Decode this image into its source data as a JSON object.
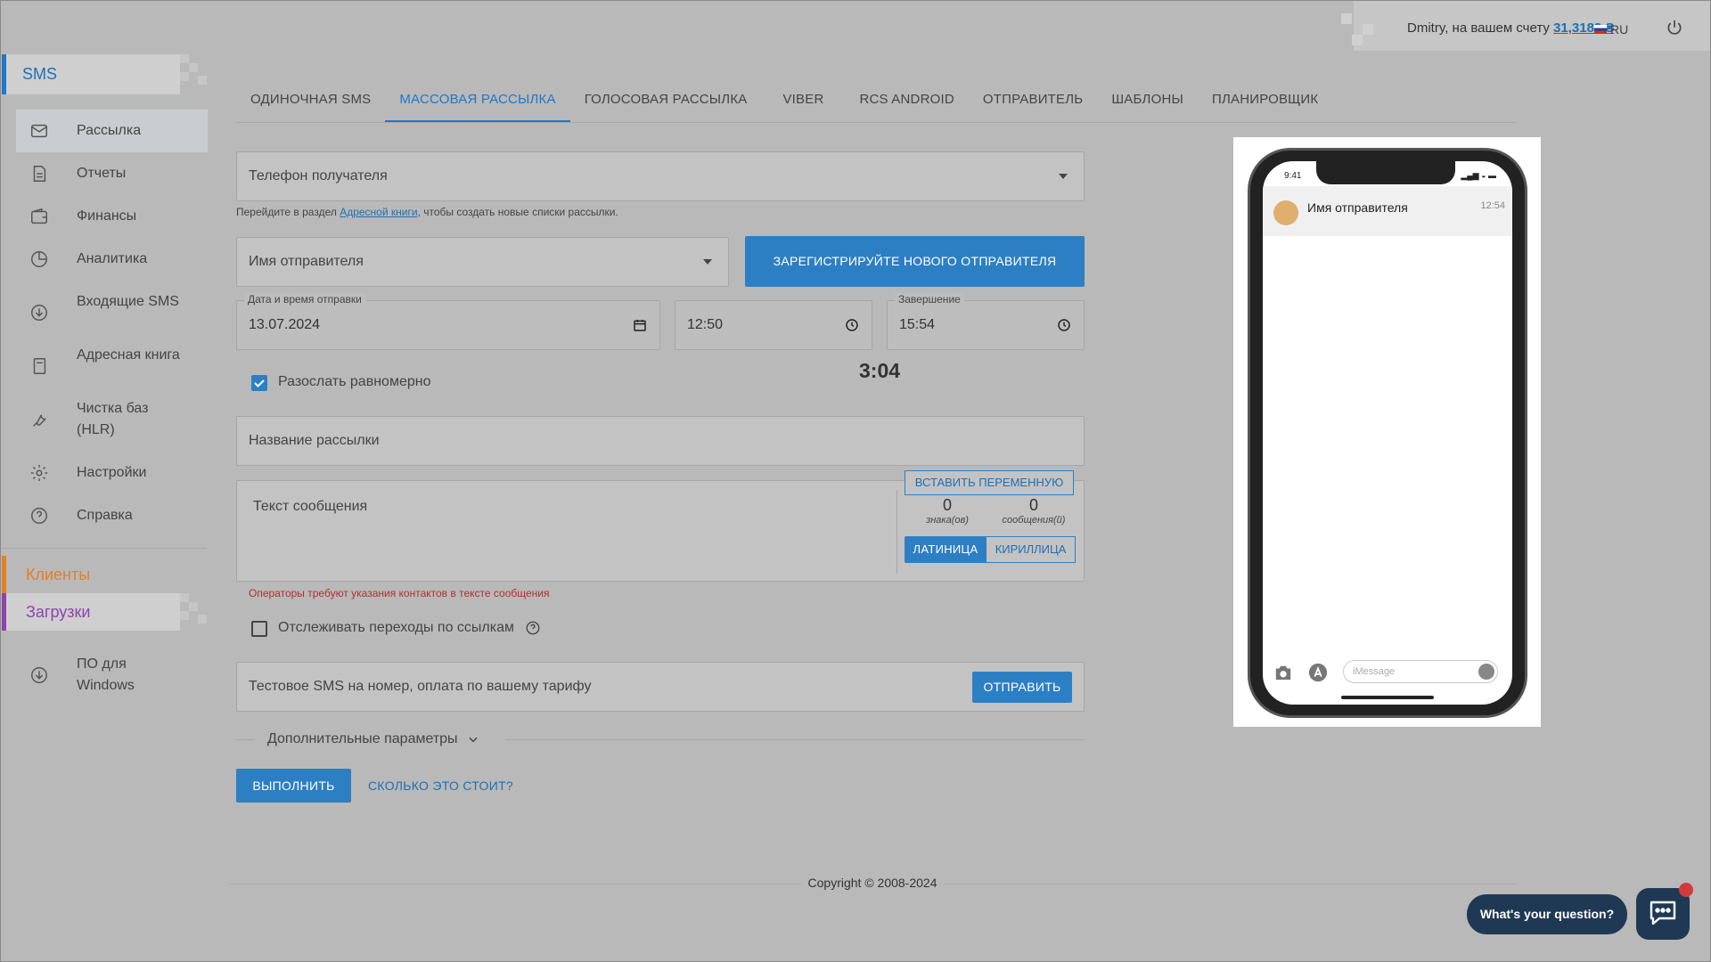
{
  "topbar": {
    "user_text": "Dmitry, на вашем счету",
    "balance": "31,3183 ₴",
    "lang": "RU"
  },
  "sidebar": {
    "section_title": "SMS",
    "items": [
      {
        "label": "Рассылка",
        "icon": "mail-icon"
      },
      {
        "label": "Отчеты",
        "icon": "document-icon"
      },
      {
        "label": "Финансы",
        "icon": "wallet-icon"
      },
      {
        "label": "Аналитика",
        "icon": "pie-chart-icon"
      },
      {
        "label": "Входящие SMS",
        "icon": "download-circle-icon"
      },
      {
        "label": "Адресная книга",
        "icon": "book-icon"
      },
      {
        "label": "Чистка баз (HLR)",
        "icon": "wrench-icon"
      },
      {
        "label": "Настройки",
        "icon": "gear-icon"
      },
      {
        "label": "Справка",
        "icon": "help-circle-icon"
      }
    ],
    "clients": "Клиенты",
    "downloads": "Загрузки",
    "windows_software": "ПО для Windows"
  },
  "tabs": [
    "ОДИНОЧНАЯ SMS",
    "МАССОВАЯ РАССЫЛКА",
    "ГОЛОСОВАЯ РАССЫЛКА",
    "VIBER",
    "RCS ANDROID",
    "ОТПРАВИТЕЛЬ",
    "ШАБЛОНЫ",
    "ПЛАНИРОВЩИК"
  ],
  "form": {
    "recipient_placeholder": "Телефон получателя",
    "hint_before": "Перейдите в раздел ",
    "hint_link": "Адресной книги",
    "hint_after": ", чтобы создать новые списки рассылки.",
    "sender_placeholder": "Имя отправителя",
    "register_sender": "ЗАРЕГИСТРИРУЙТЕ НОВОГО ОТПРАВИТЕЛЯ",
    "date_legend": "Дата и время отправки",
    "date_value": "13.07.2024",
    "time_value": "12:50",
    "end_legend": "Завершение",
    "end_value": "15:54",
    "duration": "3:04",
    "distribute_evenly": "Разослать равномерно",
    "campaign_name_placeholder": "Название рассылки",
    "message_placeholder": "Текст сообщения",
    "insert_variable": "ВСТАВИТЬ ПЕРЕМЕННУЮ",
    "chars_count": "0",
    "chars_label": "знака(ов)",
    "msgs_count": "0",
    "msgs_label": "сообщения(й)",
    "latin": "ЛАТИНИЦА",
    "cyrillic": "КИРИЛЛИЦА",
    "operators_warning": "Операторы требуют указания контактов в тексте сообщения",
    "track_links": "Отслеживать переходы по ссылкам",
    "test_sms_placeholder": "Тестовое SMS на номер, оплата по вашему тарифу",
    "send": "ОТПРАВИТЬ",
    "advanced": "Дополнительные параметры",
    "execute": "ВЫПОЛНИТЬ",
    "how_much": "СКОЛЬКО ЭТО СТОИТ?"
  },
  "phone": {
    "clock": "9:41",
    "sender": "Имя отправителя",
    "time": "12:54",
    "input_placeholder": "iMessage"
  },
  "footer": {
    "copyright": "Copyright © 2008-2024"
  },
  "chat": {
    "bubble": "What's your question?"
  },
  "colors": {
    "accent": "#2d7fc4",
    "clients": "#e67e22",
    "downloads": "#8e44ad",
    "warning": "#c0392b"
  }
}
